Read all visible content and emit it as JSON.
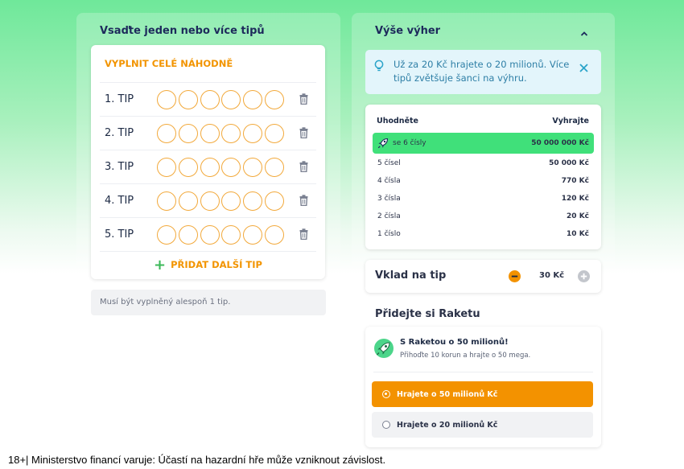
{
  "left": {
    "title": "Vsaďte jeden nebo více tipů",
    "random_fill": "VYPLNIT CELÉ NÁHODNĚ",
    "tips": [
      {
        "label": "1. TIP"
      },
      {
        "label": "2. TIP"
      },
      {
        "label": "3. TIP"
      },
      {
        "label": "4. TIP"
      },
      {
        "label": "5. TIP"
      }
    ],
    "add_tip": "PŘIDAT DALŠÍ TIP",
    "note": "Musí být vyplněný alespoň 1 tip."
  },
  "right": {
    "title": "Výše výher",
    "info": "Už za 20 Kč hrajete o 20 milionů. Více tipů zvětšuje šanci na výhru.",
    "table": {
      "col_guess": "Uhodněte",
      "col_win": "Vyhrajte",
      "rows": [
        {
          "label": "se 6 čísly",
          "amount": "50 000 000 Kč",
          "highlight": true
        },
        {
          "label": "5 čísel",
          "amount": "50 000 Kč"
        },
        {
          "label": "4 čísla",
          "amount": "770 Kč"
        },
        {
          "label": "3 čísla",
          "amount": "120 Kč"
        },
        {
          "label": "2 čísla",
          "amount": "20 Kč"
        },
        {
          "label": "1 číslo",
          "amount": "10 Kč"
        }
      ]
    },
    "stake": {
      "label": "Vklad na tip",
      "value": "30 Kč"
    },
    "raketa": {
      "title": "Přidejte si Raketu",
      "headline": "S Raketou o 50 milionů!",
      "sub": "Přihoďte 10 korun a hrajte o 50 mega.",
      "options": [
        {
          "label": "Hrajete o 50 milionů Kč",
          "selected": true
        },
        {
          "label": "Hrajete o 20 milionů Kč",
          "selected": false
        }
      ]
    }
  },
  "footer": "18+| Ministerstvo financí varuje: Účastí na hazardní hře může vzniknout závislost.",
  "colors": {
    "accent": "#f29400",
    "highlight": "#40e07a",
    "info_bg": "#e3f5fb"
  }
}
